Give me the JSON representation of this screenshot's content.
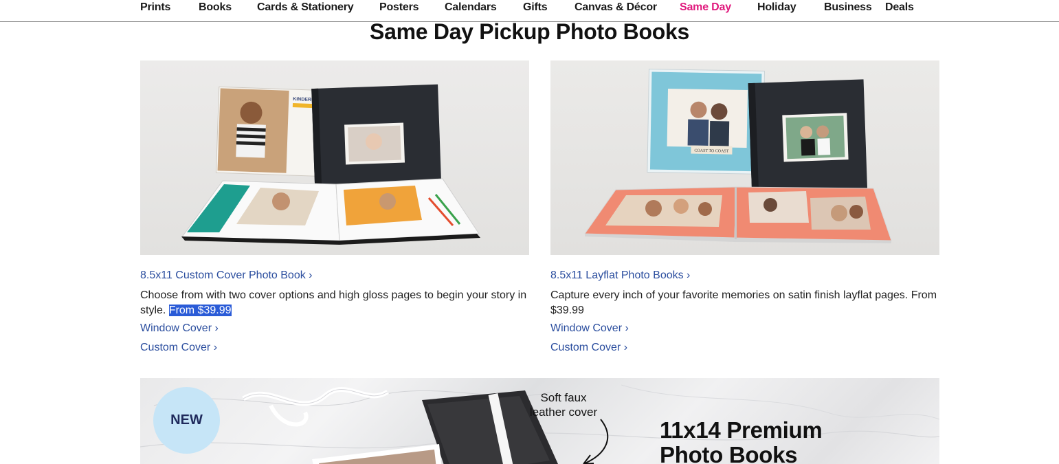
{
  "nav": {
    "items": [
      {
        "label": "Prints",
        "active": false
      },
      {
        "label": "Books",
        "active": false
      },
      {
        "label": "Cards & Stationery",
        "active": false
      },
      {
        "label": "Posters",
        "active": false
      },
      {
        "label": "Calendars",
        "active": false
      },
      {
        "label": "Gifts",
        "active": false
      },
      {
        "label": "Canvas & Décor",
        "active": false
      },
      {
        "label": "Same Day",
        "active": true
      },
      {
        "label": "Holiday",
        "active": false
      },
      {
        "label": "Business",
        "active": false
      },
      {
        "label": "Deals",
        "active": false
      }
    ]
  },
  "page": {
    "title": "Same Day Pickup Photo Books"
  },
  "products": [
    {
      "title": "8.5x11 Custom Cover Photo Book ›",
      "desc_prefix": "Choose from with two cover options and high gloss pages to begin your story in style. ",
      "price_highlighted": "From $39.99",
      "links": [
        "Window Cover ›",
        "Custom Cover ›"
      ],
      "cover_text": "KINDERG"
    },
    {
      "title": "8.5x11 Layflat Photo Books ›",
      "desc": "Capture every inch of your favorite memories on satin finish layflat pages. From $39.99",
      "links": [
        "Window Cover ›",
        "Custom Cover ›"
      ],
      "cover_text": "COAST TO COAST"
    }
  ],
  "banner": {
    "badge": "NEW",
    "note_line1": "Soft faux",
    "note_line2": "leather cover",
    "title_line1": "11x14 Premium",
    "title_line2": "Photo Books"
  },
  "colors": {
    "accent_pink": "#e0197d",
    "link_blue": "#2a4d9e",
    "highlight_blue": "#2a5bd7",
    "badge_blue": "#c6e5f7"
  }
}
